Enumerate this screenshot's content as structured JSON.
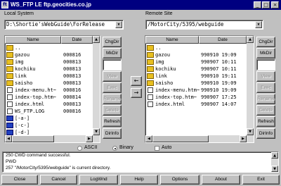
{
  "window": {
    "title": "WS_FTP LE ftp.geocities.co.jp",
    "app_icon": "ftp-icon"
  },
  "local": {
    "label": "Local System",
    "path": "D:\\Shortie'sWebGuide\\ForRelease",
    "col_name": "Name",
    "col_date": "Date",
    "rows": [
      {
        "type": "folder-up",
        "name": "..",
        "date": ""
      },
      {
        "type": "folder",
        "name": "gazou",
        "date": "000816"
      },
      {
        "type": "folder",
        "name": "img",
        "date": "000813"
      },
      {
        "type": "folder",
        "name": "kochiku",
        "date": "000813"
      },
      {
        "type": "folder",
        "name": "link",
        "date": "000813"
      },
      {
        "type": "folder",
        "name": "saisho",
        "date": "000813"
      },
      {
        "type": "file",
        "name": "index-menu.ht~",
        "date": "000816"
      },
      {
        "type": "file",
        "name": "index-top.htm~",
        "date": "000814"
      },
      {
        "type": "file",
        "name": "index.html",
        "date": "000813"
      },
      {
        "type": "file",
        "name": "WS_FTP.LOG",
        "date": "000816"
      },
      {
        "type": "drive",
        "name": "[-a-]",
        "date": ""
      },
      {
        "type": "drive",
        "name": "[-c-]",
        "date": ""
      },
      {
        "type": "drive",
        "name": "[-d-]",
        "date": ""
      }
    ],
    "buttons": [
      "ChgDir",
      "MkDir",
      "",
      "View",
      "Exec",
      "Rename",
      "Delete",
      "Refresh",
      "DirInfo"
    ]
  },
  "remote": {
    "label": "Remote Site",
    "path": "/MotorCity/5395/webguide",
    "col_name": "Name",
    "col_date": "Date",
    "rows": [
      {
        "type": "folder-up",
        "name": "..",
        "date": ""
      },
      {
        "type": "folder",
        "name": "gazou",
        "date": "990910 19:09"
      },
      {
        "type": "folder",
        "name": "img",
        "date": "990907 10:11"
      },
      {
        "type": "folder",
        "name": "kochiku",
        "date": "990907 10:11"
      },
      {
        "type": "folder",
        "name": "link",
        "date": "990910 19:11"
      },
      {
        "type": "folder",
        "name": "saisho",
        "date": "990910 19:09"
      },
      {
        "type": "file",
        "name": "index-menu.htm~",
        "date": "990910 19:09"
      },
      {
        "type": "file",
        "name": "index-top.htm~",
        "date": "990907 17:25"
      },
      {
        "type": "file",
        "name": "index.html",
        "date": "990907 14:07"
      }
    ],
    "buttons": [
      "ChgDir",
      "MkDir",
      "",
      "View",
      "Exec",
      "Rename",
      "Delete",
      "Refresh",
      "DirInfo"
    ]
  },
  "transfer": {
    "left_arrow": "←",
    "right_arrow": "→"
  },
  "mode": {
    "ascii": "ASCII",
    "binary": "Binary",
    "auto": "Auto",
    "selected": "binary"
  },
  "log": [
    "250 CWD command successful.",
    "PWD",
    "257 \"/MotorCity/5395/webguide\" is current directory."
  ],
  "bottom_buttons": [
    "Close",
    "Cancel",
    "LogWnd",
    "Help",
    "Options",
    "About",
    "Exit"
  ]
}
